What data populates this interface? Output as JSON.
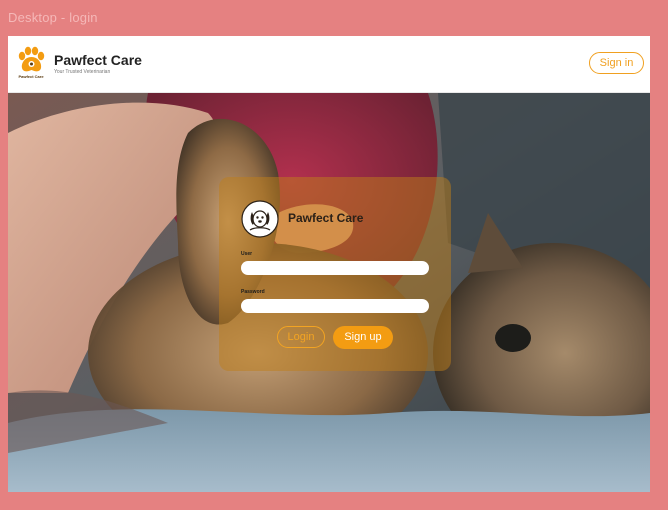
{
  "frame": {
    "label": "Desktop - login"
  },
  "header": {
    "brand_name": "Pawfect Care",
    "tagline": "Your Trusted Veterinarian",
    "logo_text": "Pawfect Care",
    "logo_icon": "paw-icon",
    "signin_label": "Sign in"
  },
  "login_card": {
    "logo_icon": "dog-icon",
    "title": "Pawfect Care",
    "user_label": "User",
    "user_value": "",
    "password_label": "Password",
    "password_value": "",
    "login_label": "Login",
    "signup_label": "Sign up"
  },
  "colors": {
    "page_background": "#e58181",
    "accent": "#f39c12",
    "card_overlay": "#be7d19"
  }
}
